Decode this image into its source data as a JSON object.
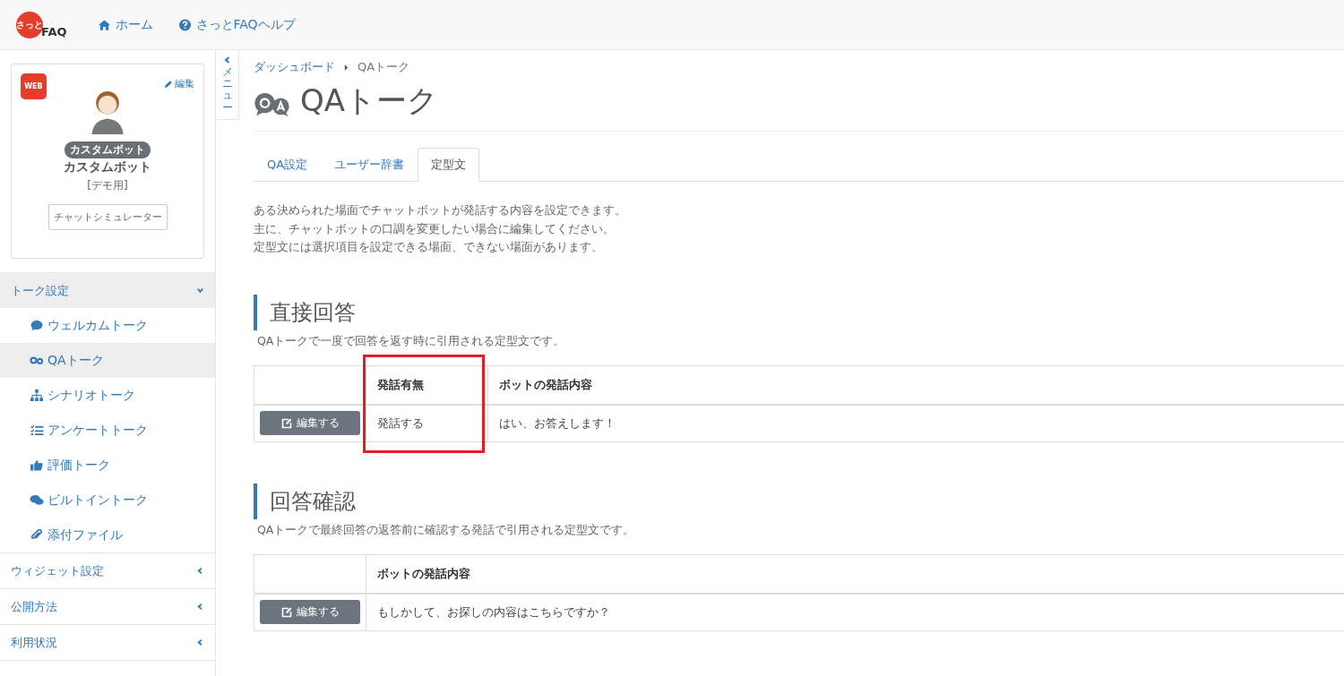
{
  "header": {
    "logo_text": "FAQ",
    "logo_mark": "さっと",
    "nav": [
      {
        "kind": "home",
        "label": "ホーム"
      },
      {
        "kind": "help",
        "label": "さっとFAQヘルプ"
      }
    ]
  },
  "bot_card": {
    "channel_badge": "WEB",
    "edit_link": "編集",
    "type_badge": "カスタムボット",
    "name": "カスタムボット",
    "note": "[デモ用]",
    "simulator_button": "チャットシミュレーター"
  },
  "menu_toggle": "メニュー",
  "sidebar": [
    {
      "label": "トーク設定",
      "expanded": true,
      "children": [
        {
          "kind": "welcome",
          "label": "ウェルカムトーク",
          "selected": false
        },
        {
          "kind": "qa",
          "label": "QAトーク",
          "selected": true
        },
        {
          "kind": "scenario",
          "label": "シナリオトーク",
          "selected": false
        },
        {
          "kind": "survey",
          "label": "アンケートトーク",
          "selected": false
        },
        {
          "kind": "rating",
          "label": "評価トーク",
          "selected": false
        },
        {
          "kind": "builtin",
          "label": "ビルトイントーク",
          "selected": false
        },
        {
          "kind": "attachment",
          "label": "添付ファイル",
          "selected": false
        }
      ]
    },
    {
      "label": "ウィジェット設定",
      "expanded": false
    },
    {
      "label": "公開方法",
      "expanded": false
    },
    {
      "label": "利用状況",
      "expanded": false
    }
  ],
  "breadcrumb": [
    "ダッシュボード",
    "QAトーク"
  ],
  "page_title": "QAトーク",
  "tabs": [
    {
      "label": "QA設定",
      "selected": false
    },
    {
      "label": "ユーザー辞書",
      "selected": false
    },
    {
      "label": "定型文",
      "selected": true
    }
  ],
  "intro": [
    "ある決められた場面でチャットボットが発話する内容を設定できます。",
    "主に、チャットボットの口調を変更したい場合に編集してください。",
    "定型文には選択項目を設定できる場面、できない場面があります。"
  ],
  "sections": [
    {
      "title": "直接回答",
      "description": "QAトークで一度で回答を返す時に引用される定型文です。",
      "columns": [
        {
          "label": "発話有無",
          "highlighted": true
        },
        {
          "label": "ボットの発話内容",
          "highlighted": false
        }
      ],
      "rows": [
        {
          "button": "編集する",
          "cells": [
            "発話する",
            "はい、お答えします！"
          ]
        }
      ]
    },
    {
      "title": "回答確認",
      "description": "QAトークで最終回答の返答前に確認する発話で引用される定型文です。",
      "columns": [
        {
          "label": "ボットの発話内容",
          "highlighted": false
        }
      ],
      "rows": [
        {
          "button": "編集する",
          "cells": [
            "もしかして、お探しの内容はこちらですか？"
          ]
        }
      ]
    }
  ]
}
